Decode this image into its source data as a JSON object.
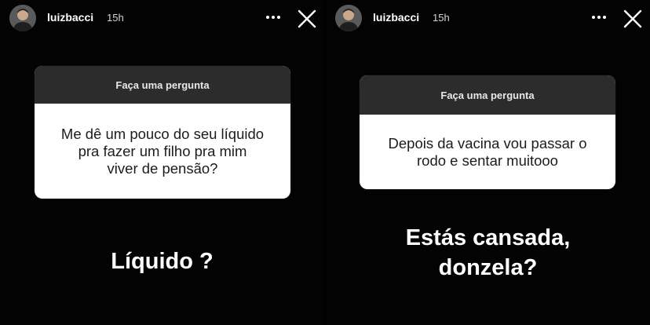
{
  "stories": [
    {
      "username": "luizbacci",
      "time": "15h",
      "question_header": "Faça uma pergunta",
      "question_lines": [
        "Me dê um pouco do seu líquido",
        "pra fazer um filho pra mim",
        "viver de pensão?"
      ],
      "answer_lines": [
        "Líquido ?"
      ]
    },
    {
      "username": "luizbacci",
      "time": "15h",
      "question_header": "Faça uma pergunta",
      "question_lines": [
        "Depois da vacina vou passar o",
        "rodo e sentar muitooo"
      ],
      "answer_lines": [
        "Estás cansada,",
        "donzela?"
      ]
    }
  ],
  "icons": {
    "more": "more-horizontal-icon",
    "close": "close-icon"
  },
  "colors": {
    "background": "#000000",
    "question_header_bg": "#2c2c2c",
    "question_body_bg": "#ffffff"
  }
}
